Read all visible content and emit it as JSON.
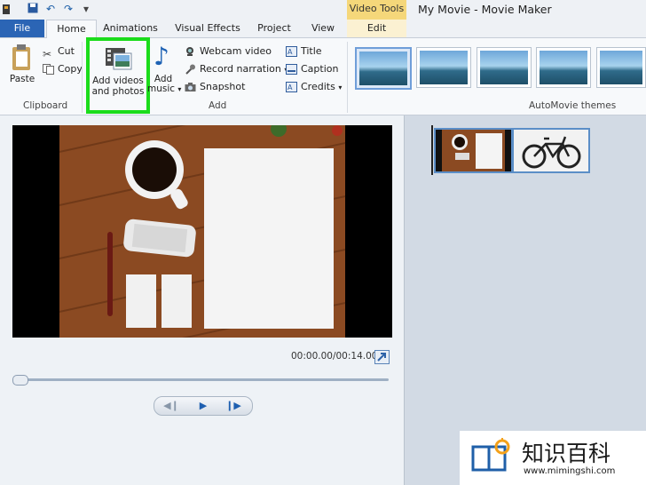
{
  "window": {
    "title": "My Movie - Movie Maker",
    "contextual_tab_group": "Video Tools"
  },
  "tabs": [
    "File",
    "Home",
    "Animations",
    "Visual Effects",
    "Project",
    "View",
    "Edit"
  ],
  "clipboard": {
    "paste": "Paste",
    "cut": "Cut",
    "copy": "Copy",
    "group_label": "Clipboard"
  },
  "add": {
    "add_videos_line1": "Add videos",
    "add_videos_line2": "and photos",
    "add_music_line1": "Add",
    "add_music_line2": "music",
    "webcam": "Webcam video",
    "record": "Record narration",
    "snapshot": "Snapshot",
    "title": "Title",
    "caption": "Caption",
    "credits": "Credits",
    "group_label": "Add"
  },
  "themes": {
    "group_label": "AutoMovie themes"
  },
  "player": {
    "timecode": "00:00.00/00:14.00"
  },
  "watermark": {
    "brand": "知识百科",
    "url": "www.mimingshi.com"
  },
  "colors": {
    "file_tab": "#2b65b5",
    "highlight": "#1bdc1b",
    "video_tools": "#f5d77a"
  }
}
